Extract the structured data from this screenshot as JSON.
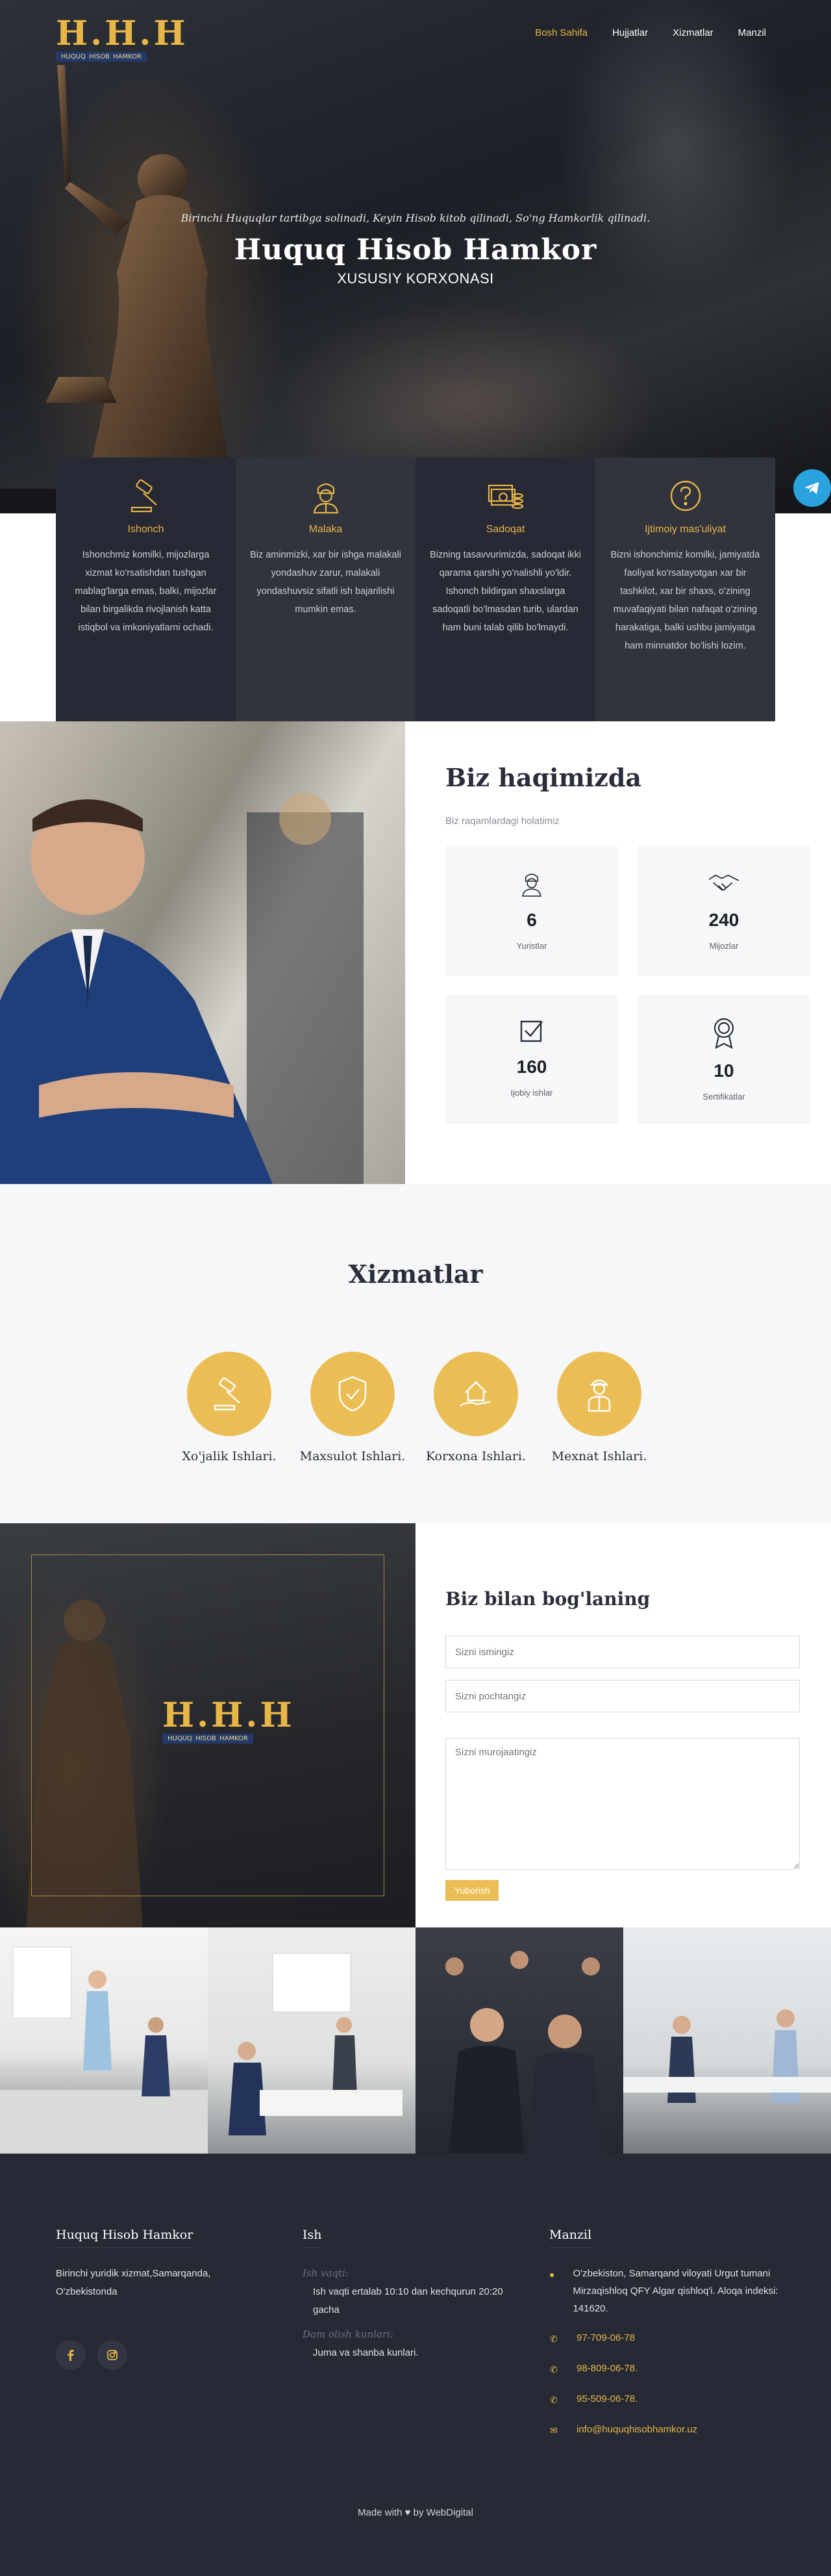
{
  "brand": {
    "logo_letters": "H.H.H",
    "logo_band_words": [
      "HUQUQ",
      "HISOB",
      "HAMKOR"
    ],
    "colors": {
      "accent": "#e8b547",
      "dark": "#262a35",
      "band": "#233a6b"
    }
  },
  "nav": {
    "items": [
      {
        "label": "Bosh Sahifa",
        "active": true
      },
      {
        "label": "Hujjatlar",
        "active": false
      },
      {
        "label": "Xizmatlar",
        "active": false
      },
      {
        "label": "Manzil",
        "active": false
      }
    ]
  },
  "hero": {
    "motto": "Birinchi Huquqlar tartibga solinadi, Keyin Hisob kitob qilinadi, So'ng Hamkorlik qilinadi.",
    "title": "Huquq Hisob Hamkor",
    "subtitle": "XUSUSIY KORXONASI",
    "telegram_icon": "telegram-icon"
  },
  "features": [
    {
      "icon": "gavel-icon",
      "title": "Ishonch",
      "text": "Ishonchmiz komilki, mijozlarga xizmat ko'rsatishdan tushgan mablag'larga emas, balki, mijozlar bilan birgalikda rivojlanish katta istiqbol va imkoniyatlarni ochadi."
    },
    {
      "icon": "lawyer-icon",
      "title": "Malaka",
      "text": "Biz aminmizki, xar bir ishga malakali yondashuv zarur, malakali yondashuvsiz sifatli ish bajarilishi mumkin emas."
    },
    {
      "icon": "money-icon",
      "title": "Sadoqat",
      "text": "Bizning tasavvurimizda, sadoqat ikki qarama qarshi yo'nalishli yo'ldir. Ishonch bildirgan shaxslarga sadoqatli bo'lmasdan turib, ulardan ham buni talab qilib bo'lmaydi."
    },
    {
      "icon": "question-icon",
      "title": "Ijtimoiy mas'uliyat",
      "text": "Bizni ishonchimiz komilki, jamiyatda faoliyat ko'rsatayotgan xar bir tashkilot, xar bir shaxs, o'zining muvafaqiyati bilan nafaqat o'zining harakatiga, balki ushbu jamiyatga ham minnatdor bo'lishi lozim."
    }
  ],
  "about": {
    "title": "Biz haqimizda",
    "subtitle": "Biz raqamlardagi holatimiz",
    "stats": [
      {
        "icon": "lawyer-icon",
        "number": "6",
        "label": "Yuristlar"
      },
      {
        "icon": "handshake-icon",
        "number": "240",
        "label": "Mijozlar"
      },
      {
        "icon": "checkbox-icon",
        "number": "160",
        "label": "Ijobiy ishlar"
      },
      {
        "icon": "award-icon",
        "number": "10",
        "label": "Sertifikatlar"
      }
    ]
  },
  "services": {
    "title": "Xizmatlar",
    "items": [
      {
        "icon": "gavel-icon",
        "label": "Xo'jalik Ishlari."
      },
      {
        "icon": "shield-icon",
        "label": "Maxsulot Ishlari."
      },
      {
        "icon": "house-hand-icon",
        "label": "Korxona Ishlari."
      },
      {
        "icon": "worker-icon",
        "label": "Mexnat Ishlari."
      }
    ]
  },
  "contact": {
    "title": "Biz bilan bog'laning",
    "name_placeholder": "Sizni ismingiz",
    "email_placeholder": "Sizni pochtangiz",
    "message_placeholder": "Sizni murojaatingiz",
    "submit_label": "Yuborish"
  },
  "footer": {
    "col1": {
      "title": "Huquq Hisob Hamkor",
      "text": "Birinchi yuridik xizmat,Samarqanda, O'zbekistonda",
      "socials": [
        "facebook-icon",
        "instagram-icon"
      ]
    },
    "col2": {
      "title": "Ish",
      "work_label": "Ish vaqti:",
      "work_hours": "Ish vaqti ertalab 10:10 dan kechqurun 20:20 gacha",
      "off_label": "Dam olish kunlari:",
      "off_days": "Juma va shanba kunlari."
    },
    "col3": {
      "title": "Manzil",
      "address": "O'zbekiston, Samarqand viloyati Urgut tumani Mirzaqishloq QFY Algar qishloq'i. Aloqa indeksi: 141620.",
      "phones": [
        "97-709-06-78",
        "98-809-06-78.",
        "95-509-06-78."
      ],
      "email": "info@huquqhisobhamkor.uz"
    },
    "copyright_made": "Made with",
    "copyright_by": "by WebDigital"
  }
}
